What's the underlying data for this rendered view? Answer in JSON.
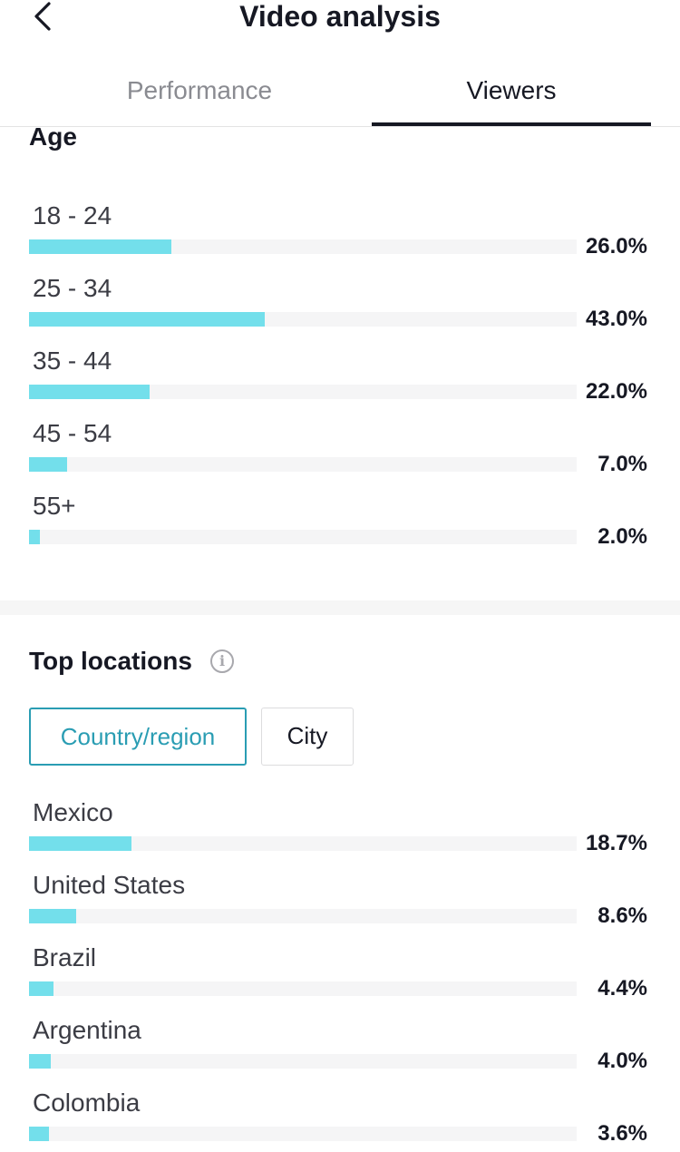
{
  "header": {
    "title": "Video analysis",
    "back_icon": "chevron-left-icon"
  },
  "tabs": [
    {
      "label": "Performance",
      "active": false
    },
    {
      "label": "Viewers",
      "active": true
    }
  ],
  "age": {
    "title": "Age",
    "rows": [
      {
        "label": "18 - 24",
        "value": 26.0,
        "display": "26.0%"
      },
      {
        "label": "25 - 34",
        "value": 43.0,
        "display": "43.0%"
      },
      {
        "label": "35 - 44",
        "value": 22.0,
        "display": "22.0%"
      },
      {
        "label": "45 - 54",
        "value": 7.0,
        "display": "7.0%"
      },
      {
        "label": "55+",
        "value": 2.0,
        "display": "2.0%"
      }
    ]
  },
  "locations": {
    "title": "Top locations",
    "info_icon": "info-icon",
    "filters": [
      {
        "label": "Country/region",
        "selected": true
      },
      {
        "label": "City",
        "selected": false
      }
    ],
    "rows": [
      {
        "label": "Mexico",
        "value": 18.7,
        "display": "18.7%"
      },
      {
        "label": "United States",
        "value": 8.6,
        "display": "8.6%"
      },
      {
        "label": "Brazil",
        "value": 4.4,
        "display": "4.4%"
      },
      {
        "label": "Argentina",
        "value": 4.0,
        "display": "4.0%"
      },
      {
        "label": "Colombia",
        "value": 3.6,
        "display": "3.6%"
      }
    ]
  },
  "colors": {
    "bar_fill": "#73dfeb",
    "bar_track": "#f5f5f6",
    "accent": "#2a9db3",
    "text": "#161823"
  }
}
